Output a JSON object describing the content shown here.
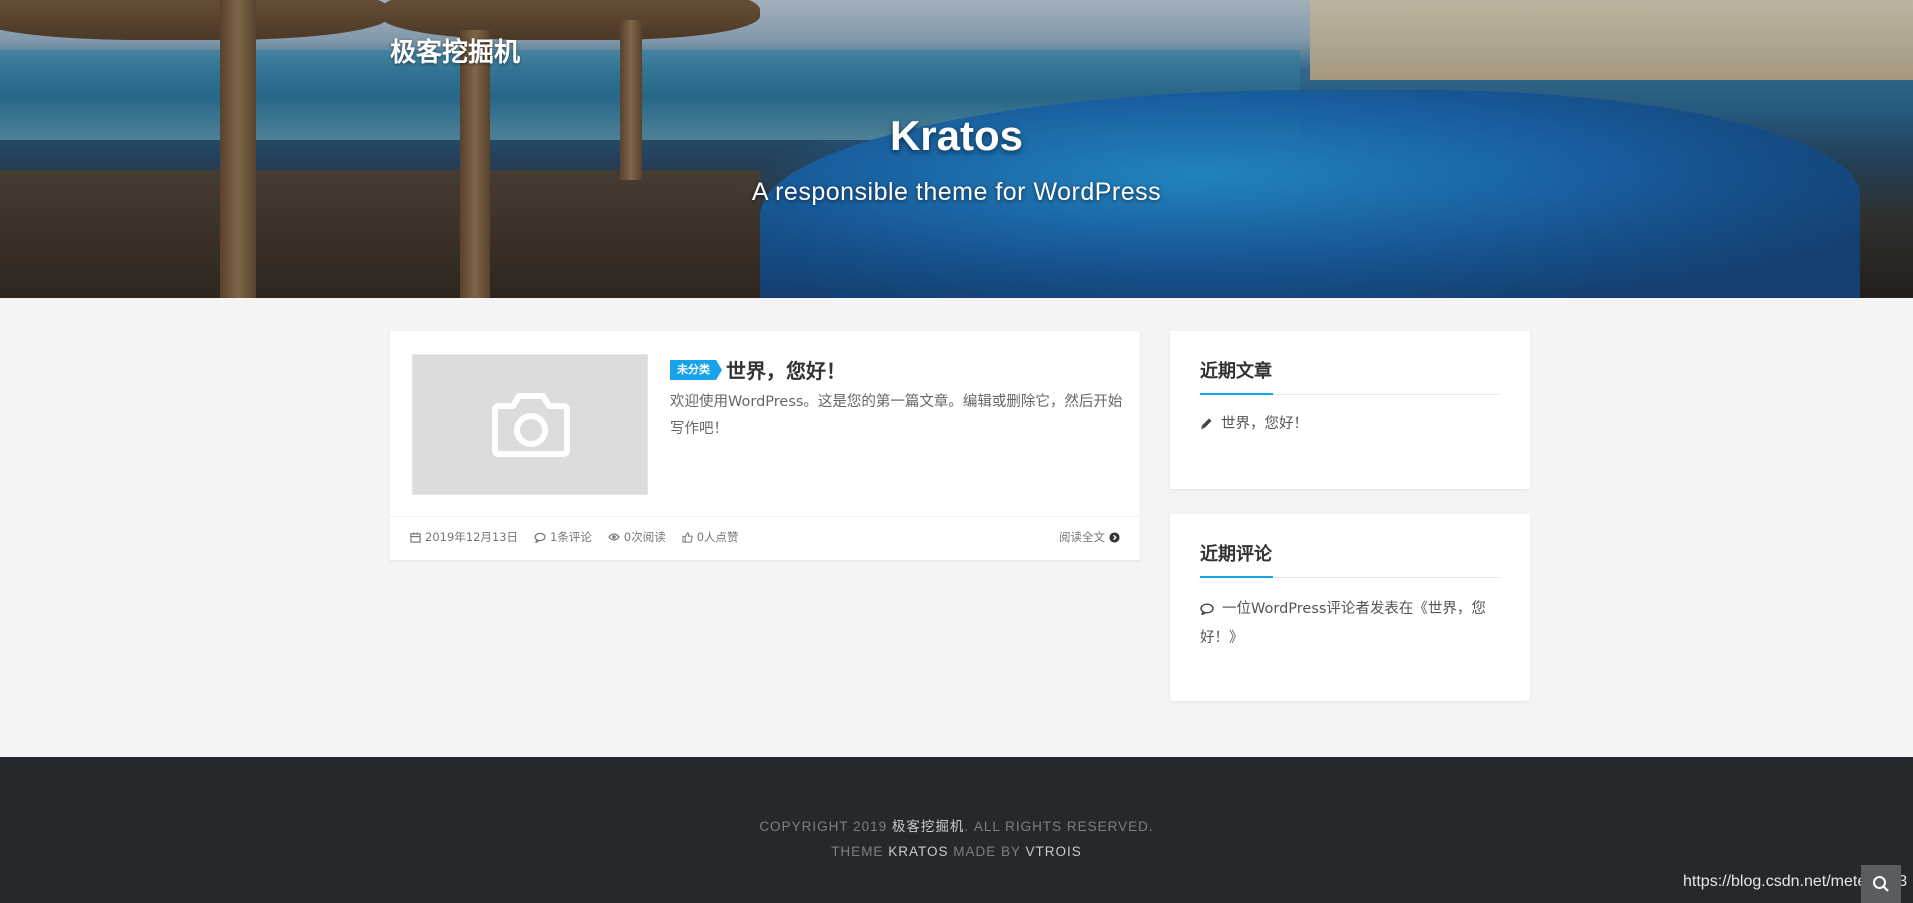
{
  "header": {
    "site_name": "极客挖掘机",
    "title": "Kratos",
    "subtitle": "A responsible theme for WordPress"
  },
  "post": {
    "category": "未分类",
    "title": "世界，您好！",
    "excerpt": "欢迎使用WordPress。这是您的第一篇文章。编辑或删除它，然后开始写作吧！",
    "date": "2019年12月13日",
    "comments": "1条评论",
    "views": "0次阅读",
    "likes": "0人点赞",
    "read_more": "阅读全文",
    "thumbnail_icon": "camera-icon"
  },
  "sidebar": {
    "recent_posts": {
      "title": "近期文章",
      "items": [
        "世界，您好！"
      ]
    },
    "recent_comments": {
      "title": "近期评论",
      "items": [
        "一位WordPress评论者发表在《世界，您好！》"
      ]
    }
  },
  "footer": {
    "copyright_prefix": "COPYRIGHT 2019",
    "copyright_name": "极客挖掘机",
    "copyright_suffix": ". ALL RIGHTS RESERVED.",
    "theme_prefix": "THEME",
    "theme_name": "KRATOS",
    "made_by": "MADE BY",
    "author": "VTROIS"
  },
  "watermark": "https://blog.csdn.net/meteor_93",
  "colors": {
    "accent": "#1aa3ea",
    "footer_bg": "#25282c",
    "page_bg": "#f4f4f4"
  }
}
